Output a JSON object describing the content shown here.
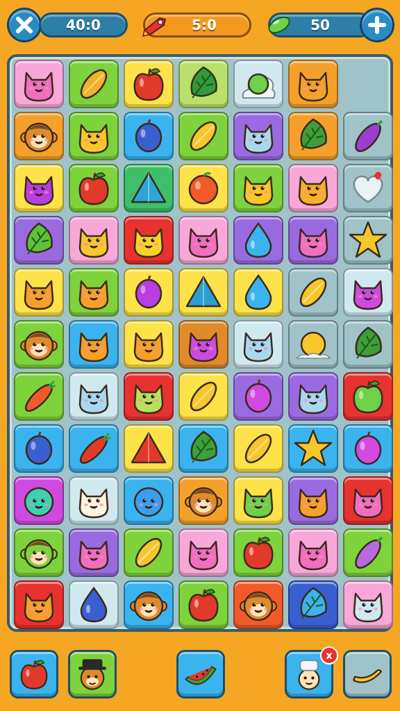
{
  "hud": {
    "moves_value": "40:0",
    "timer_value": "5:0",
    "gems_value": "50"
  },
  "board": {
    "rows": [
      [
        {
          "item": "cat",
          "bg": "#f7a8d8",
          "c": "#f06fc0"
        },
        {
          "item": "mango",
          "bg": "#7ed23b",
          "c": "#f2b12a"
        },
        {
          "item": "apple",
          "bg": "#fde24a",
          "c": "#e23a2a"
        },
        {
          "item": "leaf",
          "bg": "#b8e06a",
          "c": "#2f9b3a"
        },
        {
          "item": "bush",
          "bg": "#cfe9ef",
          "c": "#6fd04a"
        },
        {
          "item": "cat",
          "bg": "#f5a02b",
          "c": "#f5a02b"
        },
        {
          "item": "empty",
          "bg": "",
          "c": ""
        }
      ],
      [
        {
          "item": "monkey",
          "bg": "#f5a02b",
          "c": "#e08a2a"
        },
        {
          "item": "cat",
          "bg": "#7ed23b",
          "c": "#f7c62a"
        },
        {
          "item": "plum",
          "bg": "#3ab3ee",
          "c": "#3a5fd0"
        },
        {
          "item": "mango",
          "bg": "#7ed23b",
          "c": "#f7c62a"
        },
        {
          "item": "cat",
          "bg": "#9a6be0",
          "c": "#a8d8f0"
        },
        {
          "item": "leaf",
          "bg": "#f5a02b",
          "c": "#3e9e3a"
        },
        {
          "item": "eggplant",
          "bg": "#9fc3c9",
          "c": "#9a3ed0"
        }
      ],
      [
        {
          "item": "cat",
          "bg": "#fde24a",
          "c": "#b83ee0"
        },
        {
          "item": "apple",
          "bg": "#7ed23b",
          "c": "#e23a2a"
        },
        {
          "item": "triangle",
          "bg": "#3fbf6a",
          "c": "#2ea5d8"
        },
        {
          "item": "orange",
          "bg": "#fde24a",
          "c": "#f25a2a"
        },
        {
          "item": "cat",
          "bg": "#7ed23b",
          "c": "#f7c62a"
        },
        {
          "item": "cat",
          "bg": "#f7a8d8",
          "c": "#f7b02a"
        },
        {
          "item": "heart",
          "bg": "#9fc3c9",
          "c": "#e8f2f5"
        }
      ],
      [
        {
          "item": "leaf",
          "bg": "#9a6be0",
          "c": "#5ec23a"
        },
        {
          "item": "cat",
          "bg": "#f7a8d8",
          "c": "#f7c62a"
        },
        {
          "item": "cat",
          "bg": "#e8322f",
          "c": "#f7d22a"
        },
        {
          "item": "cat",
          "bg": "#f7a8d8",
          "c": "#f06fc0"
        },
        {
          "item": "drop",
          "bg": "#9a6be0",
          "c": "#3ab3ee"
        },
        {
          "item": "cat",
          "bg": "#9a6be0",
          "c": "#f06fc0"
        },
        {
          "item": "star",
          "bg": "#9fc3c9",
          "c": "#f7c62a"
        }
      ],
      [
        {
          "item": "cat",
          "bg": "#fde24a",
          "c": "#f5a02b"
        },
        {
          "item": "cat",
          "bg": "#7ed23b",
          "c": "#f5a02b"
        },
        {
          "item": "plum",
          "bg": "#fde24a",
          "c": "#b83ee0"
        },
        {
          "item": "triangle",
          "bg": "#fde24a",
          "c": "#2e9ed0"
        },
        {
          "item": "drop",
          "bg": "#fde24a",
          "c": "#3ab3ee"
        },
        {
          "item": "mango",
          "bg": "#9fc3c9",
          "c": "#f7c62a"
        },
        {
          "item": "cat",
          "bg": "#cfe9ef",
          "c": "#d04ae0"
        }
      ],
      [
        {
          "item": "monkey",
          "bg": "#7ed23b",
          "c": "#e08a2a"
        },
        {
          "item": "cat",
          "bg": "#3ab3ee",
          "c": "#f5a02b"
        },
        {
          "item": "cat",
          "bg": "#fde24a",
          "c": "#f5a02b"
        },
        {
          "item": "cat",
          "bg": "#e08a2a",
          "c": "#d04ae0"
        },
        {
          "item": "cat",
          "bg": "#cfe9ef",
          "c": "#a8d8f0"
        },
        {
          "item": "sun",
          "bg": "#9fc3c9",
          "c": "#f7c62a"
        },
        {
          "item": "leaf",
          "bg": "#9fc3c9",
          "c": "#3e9e3a"
        }
      ],
      [
        {
          "item": "carrot",
          "bg": "#7ed23b",
          "c": "#f25a2a"
        },
        {
          "item": "cat",
          "bg": "#cfe9ef",
          "c": "#a8d8f0"
        },
        {
          "item": "cat",
          "bg": "#e8322f",
          "c": "#b8e05a"
        },
        {
          "item": "mango",
          "bg": "#fde24a",
          "c": "#f7c62a"
        },
        {
          "item": "plum",
          "bg": "#9a6be0",
          "c": "#d04ae0"
        },
        {
          "item": "cat",
          "bg": "#9a6be0",
          "c": "#a8d8f0"
        },
        {
          "item": "apple",
          "bg": "#e8322f",
          "c": "#6fd04a"
        }
      ],
      [
        {
          "item": "plum",
          "bg": "#3ab3ee",
          "c": "#3a5fd0"
        },
        {
          "item": "carrot",
          "bg": "#3ab3ee",
          "c": "#e23a2a"
        },
        {
          "item": "triangle",
          "bg": "#fde24a",
          "c": "#e23a2a"
        },
        {
          "item": "leaf",
          "bg": "#3ab3ee",
          "c": "#3e9e3a"
        },
        {
          "item": "mango",
          "bg": "#fde24a",
          "c": "#f7c62a"
        },
        {
          "item": "star",
          "bg": "#3ab3ee",
          "c": "#f7c62a"
        },
        {
          "item": "plum",
          "bg": "#3ab3ee",
          "c": "#d04ae0"
        }
      ],
      [
        {
          "item": "blob",
          "bg": "#d04ae0",
          "c": "#3ed0b0"
        },
        {
          "item": "cat",
          "bg": "#cfe9ef",
          "c": "#fff5e0"
        },
        {
          "item": "blob",
          "bg": "#3ab3ee",
          "c": "#3a9ef0"
        },
        {
          "item": "monkey",
          "bg": "#f5a02b",
          "c": "#e08a2a"
        },
        {
          "item": "cat",
          "bg": "#fde24a",
          "c": "#6fd04a"
        },
        {
          "item": "cat",
          "bg": "#9a6be0",
          "c": "#f5a02b"
        },
        {
          "item": "cat",
          "bg": "#e8322f",
          "c": "#f06fc0"
        }
      ],
      [
        {
          "item": "monkey",
          "bg": "#7ed23b",
          "c": "#7ed23b"
        },
        {
          "item": "cat",
          "bg": "#9a6be0",
          "c": "#f06fc0"
        },
        {
          "item": "mango",
          "bg": "#7ed23b",
          "c": "#f7c62a"
        },
        {
          "item": "cat",
          "bg": "#f7a8d8",
          "c": "#f06fc0"
        },
        {
          "item": "apple",
          "bg": "#7ed23b",
          "c": "#e23a2a"
        },
        {
          "item": "cat",
          "bg": "#f7a8d8",
          "c": "#f06fc0"
        },
        {
          "item": "eggplant",
          "bg": "#7ed23b",
          "c": "#b86ae0"
        }
      ],
      [
        {
          "item": "cat",
          "bg": "#e8322f",
          "c": "#f5a02b"
        },
        {
          "item": "drop",
          "bg": "#cfe9ef",
          "c": "#3a5fd0"
        },
        {
          "item": "monkey",
          "bg": "#3ab3ee",
          "c": "#e08a2a"
        },
        {
          "item": "apple",
          "bg": "#7ed23b",
          "c": "#e23a2a"
        },
        {
          "item": "monkey",
          "bg": "#f25a2a",
          "c": "#e08a2a"
        },
        {
          "item": "leaf",
          "bg": "#3a5fd0",
          "c": "#3ab3ee"
        },
        {
          "item": "cat",
          "bg": "#f7a8d8",
          "c": "#cfe9ef"
        }
      ]
    ]
  },
  "powerups": [
    {
      "item": "apple",
      "bg": "#3ab3ee",
      "c": "#e23a2a"
    },
    {
      "item": "hat-monkey",
      "bg": "#7ed23b",
      "c": "#e08a2a"
    },
    {
      "item": "watermelon",
      "bg": "#3ab3ee",
      "c": "#e23a2a"
    },
    {
      "item": "chef",
      "bg": "#3ab3ee",
      "c": "#e08a2a",
      "badge": "x"
    },
    {
      "item": "banana",
      "bg": "#9fc3c9",
      "c": "#f7c62a"
    }
  ],
  "colors": {
    "background": "#f5a623",
    "board": "#9fc3c9",
    "hud_pill": "#2e7fa8",
    "timer_pill": "#f39a1e"
  },
  "icons": {
    "close": "close-icon",
    "timer": "rocket-icon",
    "gems": "green-gem-icon",
    "add": "plus-icon"
  }
}
